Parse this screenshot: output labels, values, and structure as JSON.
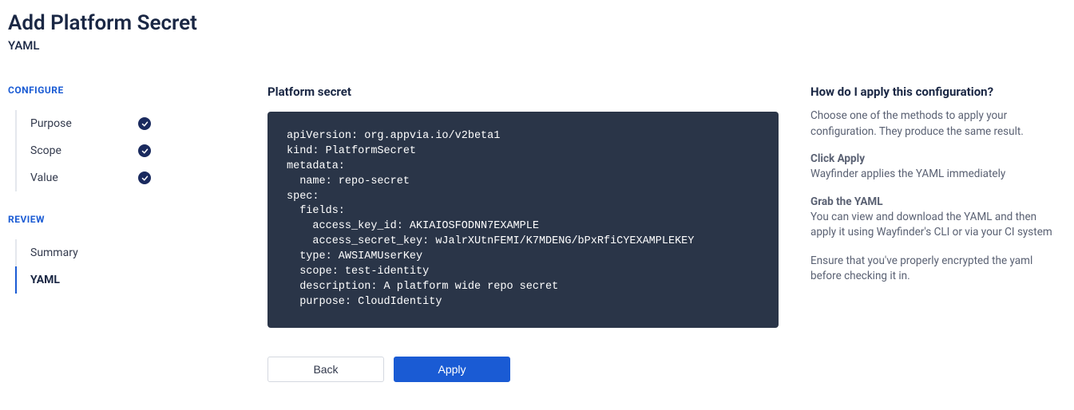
{
  "header": {
    "title": "Add Platform Secret",
    "subtitle": "YAML"
  },
  "sidebar": {
    "configure_label": "CONFIGURE",
    "review_label": "REVIEW",
    "configure_items": [
      {
        "label": "Purpose",
        "checked": true,
        "active": false
      },
      {
        "label": "Scope",
        "checked": true,
        "active": false
      },
      {
        "label": "Value",
        "checked": true,
        "active": false
      }
    ],
    "review_items": [
      {
        "label": "Summary",
        "checked": false,
        "active": false
      },
      {
        "label": "YAML",
        "checked": false,
        "active": true
      }
    ]
  },
  "main": {
    "section_title": "Platform secret",
    "yaml_content": "apiVersion: org.appvia.io/v2beta1\nkind: PlatformSecret\nmetadata:\n  name: repo-secret\nspec:\n  fields:\n    access_key_id: AKIAIOSFODNN7EXAMPLE\n    access_secret_key: wJalrXUtnFEMI/K7MDENG/bPxRfiCYEXAMPLEKEY\n  type: AWSIAMUserKey\n  scope: test-identity\n  description: A platform wide repo secret\n  purpose: CloudIdentity",
    "back_label": "Back",
    "apply_label": "Apply"
  },
  "help": {
    "title": "How do I apply this configuration?",
    "intro": "Choose one of the methods to apply your configuration. They produce the same result.",
    "sections": [
      {
        "title": "Click Apply",
        "body": "Wayfinder applies the YAML immediately"
      },
      {
        "title": "Grab the YAML",
        "body": "You can view and download the YAML and then apply it using Wayfinder's CLI or via your CI system"
      }
    ],
    "footer": "Ensure that you've properly encrypted the yaml before checking it in."
  }
}
